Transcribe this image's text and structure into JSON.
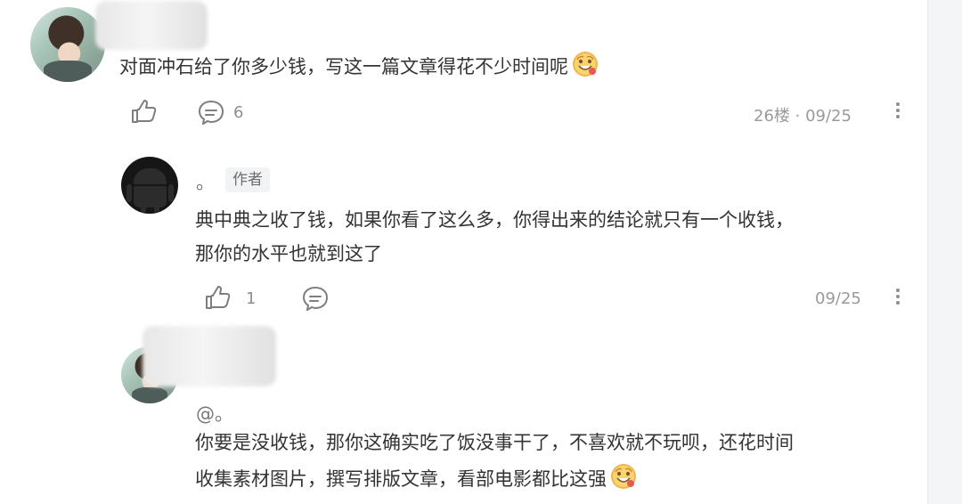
{
  "comments": {
    "top": {
      "text": "对面冲石给了你多少钱，写这一篇文章得花不少时间呢",
      "reply_count": "6",
      "meta": "26楼 · 09/25",
      "emoji_icon": "grinning-face-emoji"
    },
    "author_reply": {
      "name": "。",
      "badge": "作者",
      "line1": "典中典之收了钱，如果你看了这么多，你得出来的结论就只有一个收钱，",
      "line2": "那你的水平也就到这了",
      "like_count": "1",
      "meta": "09/25"
    },
    "user_reply": {
      "mention": "@。",
      "line1": "你要是没收钱，那你这确实吃了饭没事干了，不喜欢就不玩呗，还花时间",
      "line2": "收集素材图片，撰写排版文章，看部电影都比这强",
      "emoji_icon": "grinning-face-emoji"
    }
  },
  "icons": {
    "like": "thumbs-up-icon",
    "comment": "comment-icon",
    "more": "more-vertical-icon"
  }
}
